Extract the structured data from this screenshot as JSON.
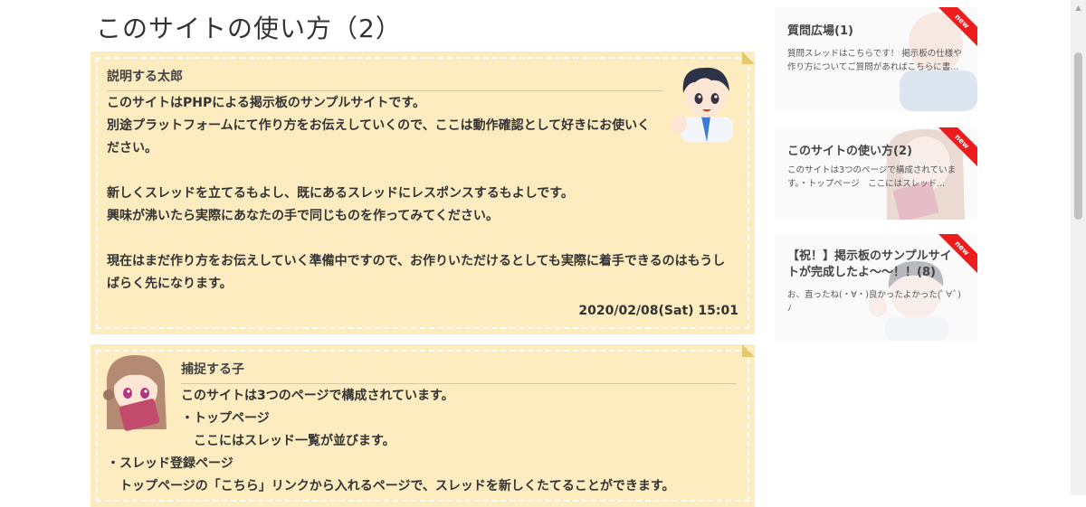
{
  "page": {
    "title": "このサイトの使い方（2）"
  },
  "posts": [
    {
      "author": "説明する太郎",
      "body": "このサイトはPHPによる掲示板のサンプルサイトです。\n別途プラットフォームにて作り方をお伝えしていくので、ここは動作確認として好きにお使いく\nださい。\n\n新しくスレッドを立てるもよし、既にあるスレッドにレスポンスするもよしです。\n興味が沸いたら実際にあなたの手で同じものを作ってみてください。\n\n現在はまだ作り方をお伝えしていく準備中ですので、お作りいただけるとしても実際に着手できるのはもうし\nばらく先になります。",
      "date": "2020/02/08(Sat) 15:01"
    },
    {
      "author": "捕捉する子",
      "body_lines": [
        "このサイトは3つのページで構成されています。",
        "・トップページ",
        "　ここにはスレッド一覧が並びます。"
      ],
      "body_lines2": [
        "・スレッド登録ページ",
        "　トップページの「こちら」リンクから入れるページで、スレッドを新しくたてることができます。"
      ]
    }
  ],
  "sidebar": {
    "cards": [
      {
        "title": "質問広場(1)",
        "text": "質問スレッドはこちらです！ 掲示板の仕様や作り方についてご質問があればこちらに書...",
        "badge": "new"
      },
      {
        "title": "このサイトの使い方(2)",
        "text": "このサイトは3つのページで構成されていま す。・トップページ　ここにはスレッド...",
        "badge": "new"
      },
      {
        "title": "【祝！】掲示板のサンプルサイトが完成したよ〜〜！！(8)",
        "text": "お、直ったね(・∀・)良かったよかった(ﾟ∀ﾟ)ﾉ",
        "badge": "new"
      }
    ]
  },
  "icons": {
    "avatar_boy": "boy-avatar-icon",
    "avatar_girl": "girl-avatar-icon",
    "scroll_up": "chevron-up-icon"
  },
  "colors": {
    "post_bg": "#fdecc0",
    "ribbon": "#ee1c1c",
    "card_bg": "#fafafa"
  }
}
